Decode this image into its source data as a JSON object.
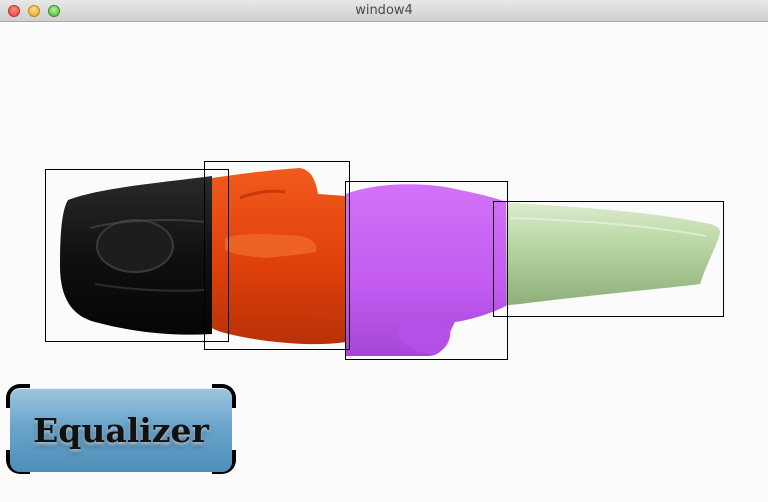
{
  "window": {
    "title": "window4"
  },
  "scene": {
    "segments": [
      {
        "name": "segment-head",
        "color": "#141414"
      },
      {
        "name": "segment-torso",
        "color": "#e2420c"
      },
      {
        "name": "segment-hips",
        "color": "#c45cf0"
      },
      {
        "name": "segment-legs",
        "color": "#b8d6a2"
      }
    ],
    "bbox_stroke": "#000000"
  },
  "equalizer": {
    "label": "Equalizer",
    "colors": {
      "top": "#9ec6df",
      "bottom": "#4f8fb8",
      "bracket": "#000000"
    }
  }
}
